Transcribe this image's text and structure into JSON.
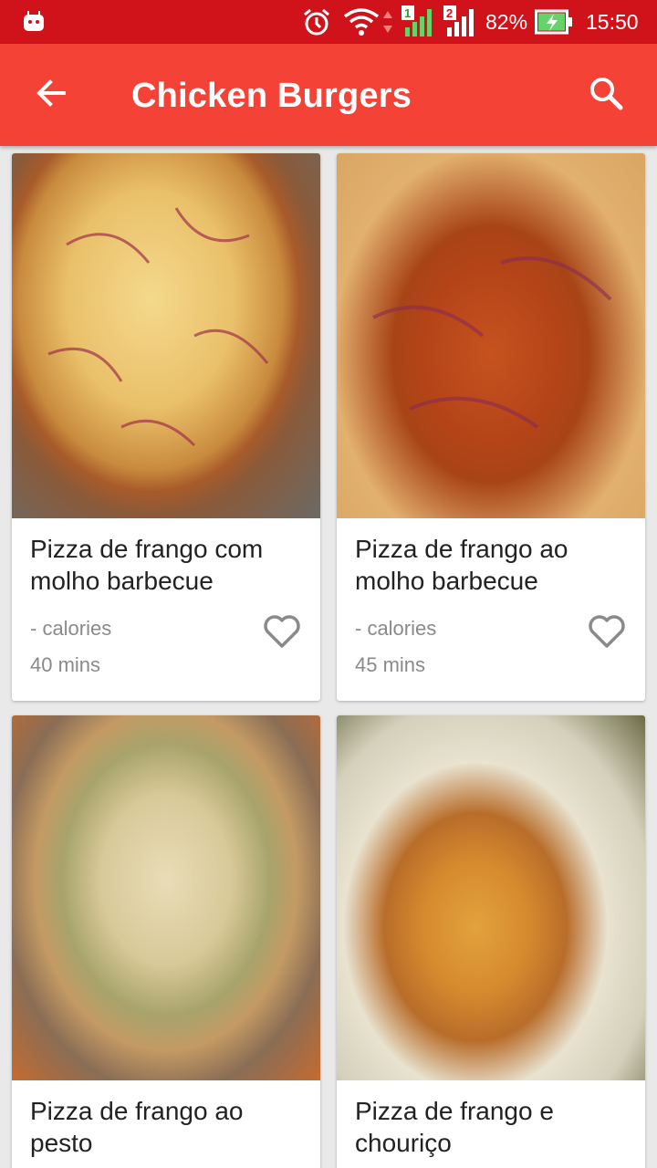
{
  "status_bar": {
    "battery_percent": "82%",
    "time": "15:50",
    "icons": [
      "android-icon",
      "alarm-icon",
      "wifi-icon",
      "sim1-signal-icon",
      "sim2-signal-icon",
      "battery-charging-icon"
    ]
  },
  "app_bar": {
    "title": "Chicken Burgers",
    "back_icon": "arrow-back-icon",
    "search_icon": "search-icon",
    "color": "#f44336"
  },
  "status_bar_color": "#d0121b",
  "recipes": [
    {
      "name": "Pizza de frango com molho barbecue",
      "calories": "- calories",
      "time": "40 mins"
    },
    {
      "name": "Pizza de frango ao molho barbecue",
      "calories": "- calories",
      "time": "45 mins"
    },
    {
      "name": "Pizza de frango ao pesto",
      "calories": "",
      "time": ""
    },
    {
      "name": "Pizza de frango e chouriço",
      "calories": "",
      "time": ""
    }
  ]
}
